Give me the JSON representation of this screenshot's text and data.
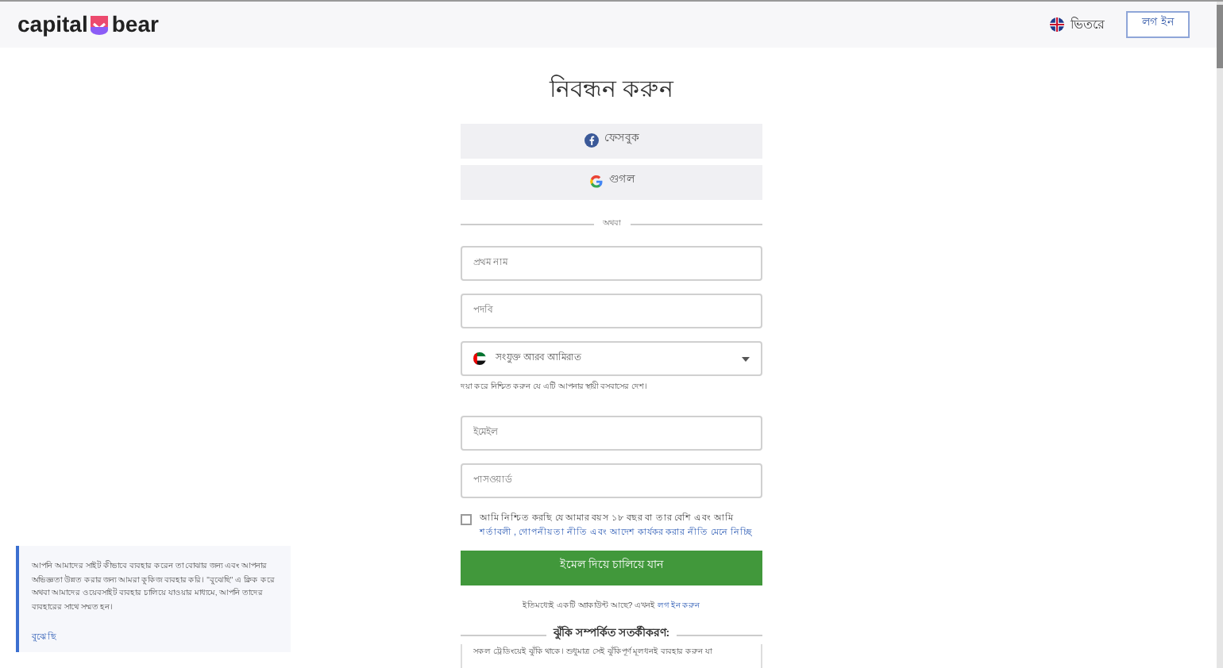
{
  "header": {
    "brand": {
      "part_1": "capital",
      "part_2": "bear"
    },
    "language": "ভিতরে",
    "login_button": "লগ ইন"
  },
  "form": {
    "title": "নিবন্ধন করুন",
    "social_buttons": [
      {
        "kind": "facebook",
        "label": "ফেসবুক"
      },
      {
        "kind": "google",
        "label": "গুগল"
      }
    ],
    "divider": "অথবা",
    "fields": [
      {
        "kind": "text",
        "placeholder": "প্রথম নাম"
      },
      {
        "kind": "text",
        "placeholder": "পদবি"
      },
      {
        "kind": "country",
        "value": "সংযুক্ত আরব আমিরাত",
        "hint": "দয়া করে নিশ্চিত করুন যে এটি আপনার স্থায়ী বসবাসের দেশ।"
      },
      {
        "kind": "text",
        "placeholder": "ইমেইল"
      },
      {
        "kind": "text",
        "placeholder": "পাসওয়ার্ড"
      }
    ],
    "consent": {
      "checked": false,
      "text": "আমি নিশ্চিত করছি যে আমার বয়স ১৮ বছর বা তার বেশি এবং আমি",
      "links": [
        {
          "label": "শর্তাবলী",
          "after": ","
        },
        {
          "label": "গোপনীয়তা নীতি",
          "after": "এবং"
        },
        {
          "label": "আদেশ কার্যকর করার নীতি",
          "after": "মেনে নিচ্ছি"
        }
      ]
    },
    "submit": "ইমেল দিয়ে চালিয়ে যান",
    "account_text": "ইতিমধ্যেই একটি অ্যাকাউন্ট আছে? এখনই",
    "account_link": "লগ ইন করুন",
    "risk_title": "ঝুঁকি সম্পর্কিত সতর্কীকরণ:",
    "risk_text": "সকল ট্রেডিংয়েই ঝুঁকি থাকে। শুধুমাত্র সেই ঝুঁকিপূর্ণ মূলধনই ব্যবহার করুন যা"
  },
  "cookie": {
    "text": "আপনি আমাদের সাইট কীভাবে ব্যবহার করেন তা বোঝার জন্য এবং আপনার অভিজ্ঞতা উন্নত করার জন্য আমরা কুকিজ ব্যবহার করি। \"বুঝেছি\" এ ক্লিক করে অথবা আমাদের ওয়েবসাইট ব্যবহার চালিয়ে যাওয়ার মাধ্যমে, আপনি তাদের ব্যবহারের সাথে সম্মত হন।",
    "button": "বুঝেছি"
  }
}
